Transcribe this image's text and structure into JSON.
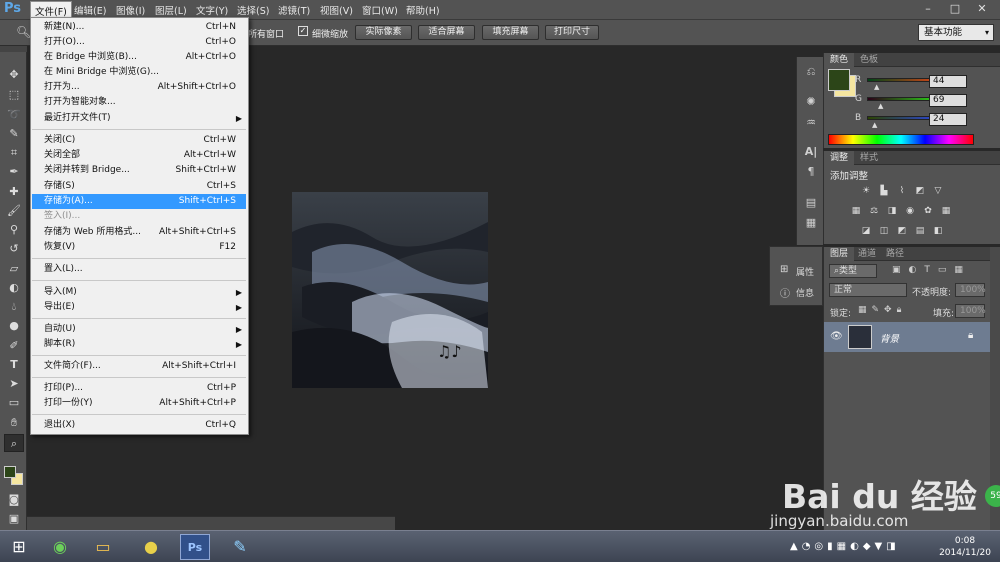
{
  "app": {
    "logo": "Ps"
  },
  "menubar": {
    "items": [
      "文件(F)",
      "编辑(E)",
      "图像(I)",
      "图层(L)",
      "文字(Y)",
      "选择(S)",
      "滤镜(T)",
      "视图(V)",
      "窗口(W)",
      "帮助(H)"
    ]
  },
  "window_controls": {
    "minimize": "–",
    "maximize": "□",
    "close": "✕"
  },
  "options": {
    "all_windows_label": "所有窗口",
    "scrubby_zoom_label": "细微缩放",
    "btn_actual": "实际像素",
    "btn_fit": "适合屏幕",
    "btn_fill": "填充屏幕",
    "btn_print": "打印尺寸",
    "workspace": "基本功能"
  },
  "file_menu": {
    "items": [
      {
        "label": "新建(N)...",
        "shortcut": "Ctrl+N"
      },
      {
        "label": "打开(O)...",
        "shortcut": "Ctrl+O"
      },
      {
        "label": "在 Bridge 中浏览(B)...",
        "shortcut": "Alt+Ctrl+O"
      },
      {
        "label": "在 Mini Bridge 中浏览(G)...",
        "shortcut": ""
      },
      {
        "label": "打开为...",
        "shortcut": "Alt+Shift+Ctrl+O"
      },
      {
        "label": "打开为智能对象...",
        "shortcut": ""
      },
      {
        "label": "最近打开文件(T)",
        "shortcut": "",
        "submenu": true
      },
      {
        "label": "关闭(C)",
        "shortcut": "Ctrl+W"
      },
      {
        "label": "关闭全部",
        "shortcut": "Alt+Ctrl+W"
      },
      {
        "label": "关闭并转到 Bridge...",
        "shortcut": "Shift+Ctrl+W"
      },
      {
        "label": "存储(S)",
        "shortcut": "Ctrl+S"
      },
      {
        "label": "存储为(A)...",
        "shortcut": "Shift+Ctrl+S",
        "highlighted": true
      },
      {
        "label": "签入(I)...",
        "shortcut": "",
        "disabled": true
      },
      {
        "label": "存储为 Web 所用格式...",
        "shortcut": "Alt+Shift+Ctrl+S"
      },
      {
        "label": "恢复(V)",
        "shortcut": "F12"
      },
      {
        "label": "置入(L)...",
        "shortcut": ""
      },
      {
        "label": "导入(M)",
        "shortcut": "",
        "submenu": true
      },
      {
        "label": "导出(E)",
        "shortcut": "",
        "submenu": true
      },
      {
        "label": "自动(U)",
        "shortcut": "",
        "submenu": true
      },
      {
        "label": "脚本(R)",
        "shortcut": "",
        "submenu": true
      },
      {
        "label": "文件简介(F)...",
        "shortcut": "Alt+Shift+Ctrl+I"
      },
      {
        "label": "打印(P)...",
        "shortcut": "Ctrl+P"
      },
      {
        "label": "打印一份(Y)",
        "shortcut": "Alt+Shift+Ctrl+P"
      },
      {
        "label": "退出(X)",
        "shortcut": "Ctrl+Q"
      }
    ]
  },
  "mini_panel": {
    "properties": "属性",
    "info": "信息"
  },
  "color_panel": {
    "tab_color": "颜色",
    "tab_swatches": "色板",
    "r_label": "R",
    "g_label": "G",
    "b_label": "B",
    "r": "44",
    "g": "69",
    "b": "24",
    "foreground": "#2c4518",
    "background": "#f5e6a0"
  },
  "adjust_panel": {
    "tab_adjust": "调整",
    "tab_styles": "样式",
    "add_label": "添加调整"
  },
  "layers_panel": {
    "tab_layers": "图层",
    "tab_channels": "通道",
    "tab_paths": "路径",
    "kind": "类型",
    "blend": "正常",
    "opacity_label": "不透明度:",
    "opacity": "100%",
    "lock_label": "锁定:",
    "fill_label": "填充:",
    "fill": "100%",
    "layer_name": "背景"
  },
  "taskbar": {
    "clock_time": "0:08",
    "clock_date": "2014/11/20"
  },
  "watermark": {
    "name": "Bai du 经验",
    "url": "jingyan.baidu.com"
  }
}
